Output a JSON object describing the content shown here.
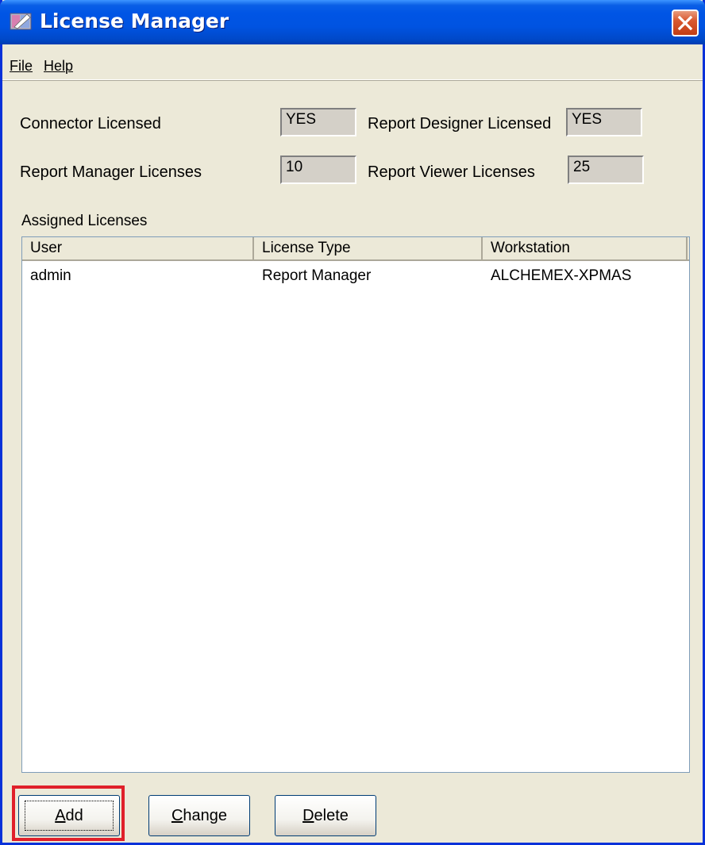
{
  "window": {
    "title": "License Manager"
  },
  "menu": [
    {
      "label": "File"
    },
    {
      "label": "Help"
    }
  ],
  "fields": {
    "connector_licensed": {
      "label": "Connector Licensed",
      "value": "YES"
    },
    "report_designer": {
      "label": "Report Designer Licensed",
      "value": "YES"
    },
    "report_manager_licenses": {
      "label": "Report Manager Licenses",
      "value": "10"
    },
    "report_viewer_licenses": {
      "label": "Report Viewer Licenses",
      "value": "25"
    }
  },
  "assigned": {
    "group_label": "Assigned Licenses",
    "columns": [
      "User",
      "License Type",
      "Workstation"
    ],
    "rows": [
      {
        "user": "admin",
        "license_type": "Report Manager",
        "workstation": "ALCHEMEX-XPMAS"
      }
    ]
  },
  "buttons": {
    "add": {
      "label": "Add",
      "mnemonic": "A",
      "rest": "dd"
    },
    "change": {
      "label": "Change",
      "mnemonic": "C",
      "rest": "hange"
    },
    "delete": {
      "label": "Delete",
      "mnemonic": "D",
      "rest": "elete"
    }
  },
  "colors": {
    "titlebar": "#0055e5",
    "window_face": "#ece9d8",
    "highlight_box": "#e0202a"
  }
}
